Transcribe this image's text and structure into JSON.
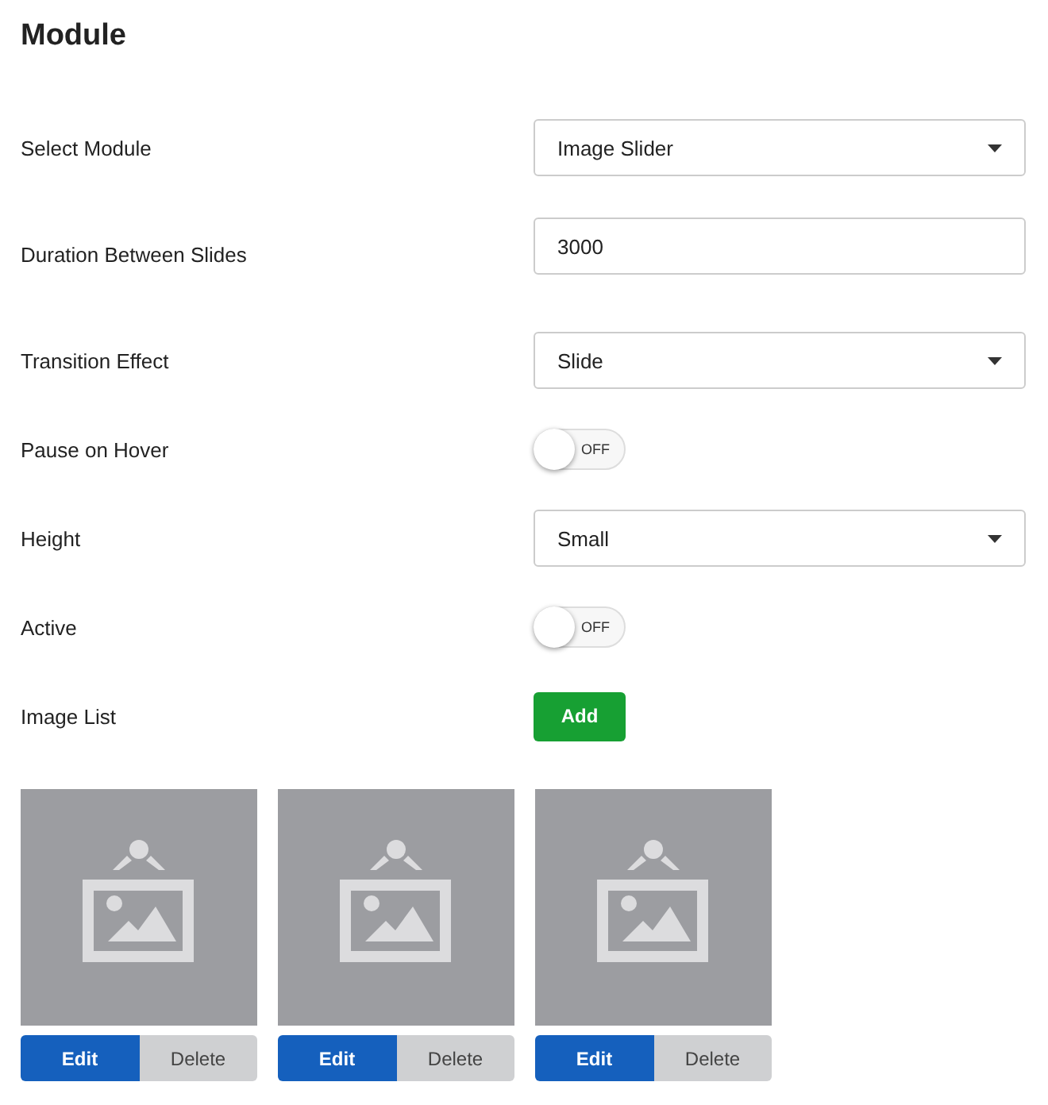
{
  "title": "Module",
  "fields": [
    {
      "kind": "select",
      "label": "Select Module",
      "value": "Image Slider"
    },
    {
      "kind": "text",
      "label": "Duration Between Slides",
      "value": "3000"
    },
    {
      "kind": "select",
      "label": "Transition Effect",
      "value": "Slide"
    },
    {
      "kind": "toggle",
      "label": "Pause on Hover",
      "on": false,
      "text": "OFF"
    },
    {
      "kind": "select",
      "label": "Height",
      "value": "Small"
    },
    {
      "kind": "toggle",
      "label": "Active",
      "on": false,
      "text": "OFF"
    },
    {
      "kind": "button",
      "label": "Image List",
      "button": "Add"
    }
  ],
  "images": [
    {
      "edit": "Edit",
      "delete": "Delete"
    },
    {
      "edit": "Edit",
      "delete": "Delete"
    },
    {
      "edit": "Edit",
      "delete": "Delete"
    }
  ]
}
